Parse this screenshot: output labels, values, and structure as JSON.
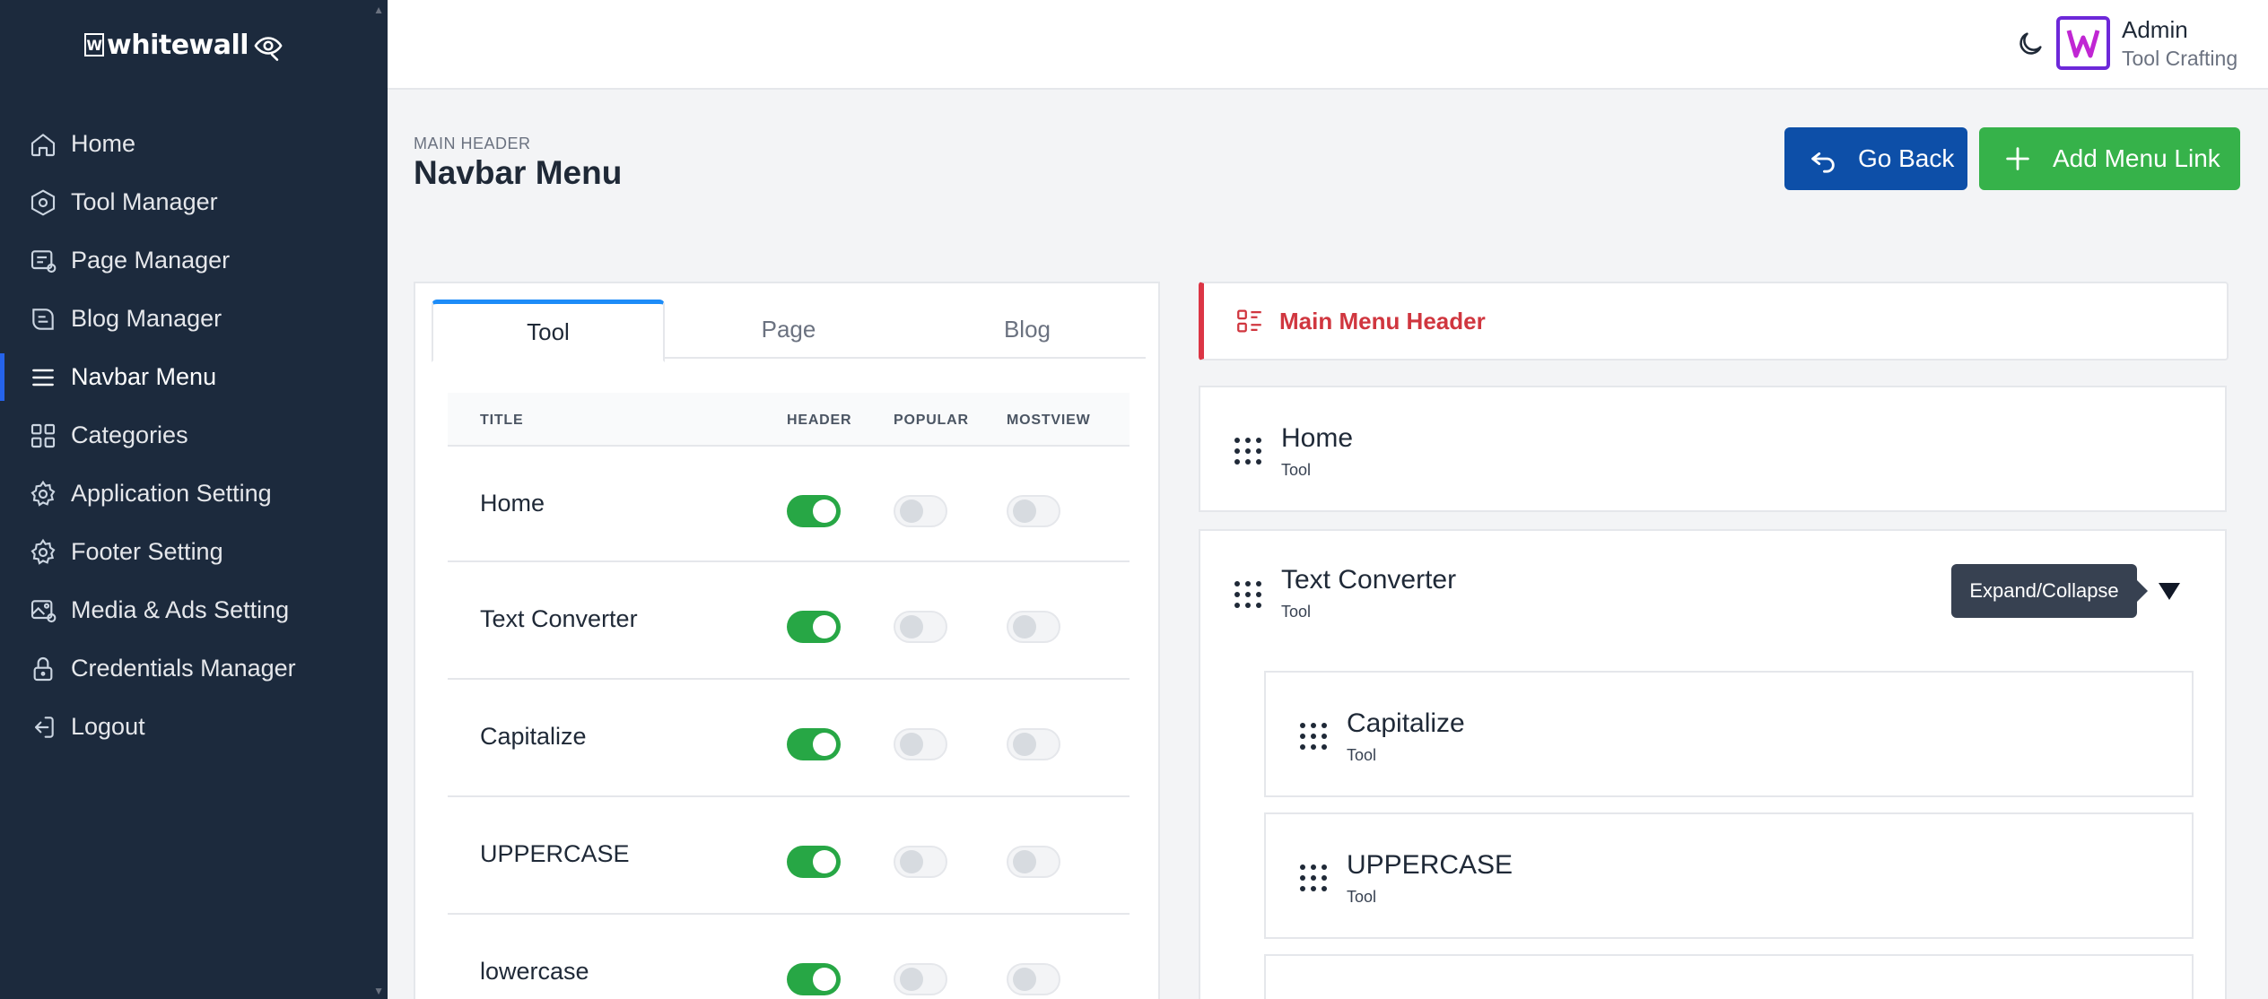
{
  "brand": {
    "name": "whitewall",
    "mark": "W"
  },
  "sidebar": {
    "items": [
      {
        "label": "Home",
        "icon": "home-icon"
      },
      {
        "label": "Tool Manager",
        "icon": "hexagon-icon"
      },
      {
        "label": "Page Manager",
        "icon": "page-settings-icon"
      },
      {
        "label": "Blog Manager",
        "icon": "blog-icon"
      },
      {
        "label": "Navbar Menu",
        "icon": "menu-icon",
        "active": true
      },
      {
        "label": "Categories",
        "icon": "grid-icon"
      },
      {
        "label": "Application Setting",
        "icon": "gear-icon"
      },
      {
        "label": "Footer Setting",
        "icon": "gear-icon"
      },
      {
        "label": "Media & Ads Setting",
        "icon": "image-settings-icon"
      },
      {
        "label": "Credentials Manager",
        "icon": "lock-icon"
      },
      {
        "label": "Logout",
        "icon": "logout-icon"
      }
    ]
  },
  "topbar": {
    "user_name": "Admin",
    "user_role": "Tool Crafting"
  },
  "header": {
    "eyebrow": "MAIN HEADER",
    "title": "Navbar Menu",
    "go_back": "Go Back",
    "add_link": "Add Menu Link"
  },
  "tabs": [
    "Tool",
    "Page",
    "Blog"
  ],
  "table": {
    "columns": [
      "TITLE",
      "HEADER",
      "POPULAR",
      "MOSTVIEW"
    ],
    "rows": [
      {
        "title": "Home",
        "header": true,
        "popular": false,
        "mostview": false
      },
      {
        "title": "Text Converter",
        "header": true,
        "popular": false,
        "mostview": false
      },
      {
        "title": "Capitalize",
        "header": true,
        "popular": false,
        "mostview": false
      },
      {
        "title": "UPPERCASE",
        "header": true,
        "popular": false,
        "mostview": false
      },
      {
        "title": "lowercase",
        "header": true,
        "popular": false,
        "mostview": false
      }
    ]
  },
  "menu": {
    "section_title": "Main Menu Header",
    "items": [
      {
        "title": "Home",
        "type": "Tool"
      },
      {
        "title": "Text Converter",
        "type": "Tool"
      },
      {
        "title": "Capitalize",
        "type": "Tool"
      },
      {
        "title": "UPPERCASE",
        "type": "Tool"
      }
    ],
    "tooltip": "Expand/Collapse"
  },
  "colors": {
    "sidebar_bg": "#1c2a3d",
    "primary_blue": "#0d4fa8",
    "success_green": "#36b24a",
    "danger_red": "#d0363f",
    "tab_accent": "#1d8cf8"
  }
}
